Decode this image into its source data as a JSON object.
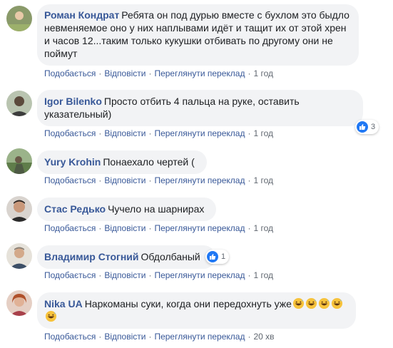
{
  "action_labels": {
    "like": "Подобається",
    "reply": "Відповісти",
    "translation": "Переглянути переклад",
    "separator": "·"
  },
  "comments": [
    {
      "author": "Роман Кондрат",
      "text": "Ребята он под дурью вместе с бухлом это быдло невменяемое оно у них наплывами идёт и тащит их от этой хрен и часов 12...таким только кукушки отбивать по другому они не поймут",
      "time": "1 год"
    },
    {
      "author": "Igor Bilenko",
      "text": "Просто отбить 4 пальца на руке, оставить указательный)",
      "time": "1 год",
      "reaction_count": "3"
    },
    {
      "author": "Yury Krohin",
      "text": "Понаехало чертей (",
      "time": "1 год"
    },
    {
      "author": "Стас Редько",
      "text": "Чучело на шарнирах",
      "time": "1 год"
    },
    {
      "author": "Владимир Стогний",
      "text": "Обдолбаный",
      "time": "1 год",
      "reaction_count": "1"
    },
    {
      "author": "Nika UA",
      "text": "Наркоманы суки, когда они передохнуть уже",
      "time": "20 хв",
      "emoji": [
        "grinning-sweat-face",
        "grinning-sweat-face",
        "grinning-sweat-face",
        "grinning-sweat-face",
        "grinning-sweat-face"
      ]
    }
  ],
  "colors": {
    "author": "#385898",
    "bubble": "#f2f3f5",
    "meta": "#606770",
    "like_blue": "#2078f4"
  }
}
